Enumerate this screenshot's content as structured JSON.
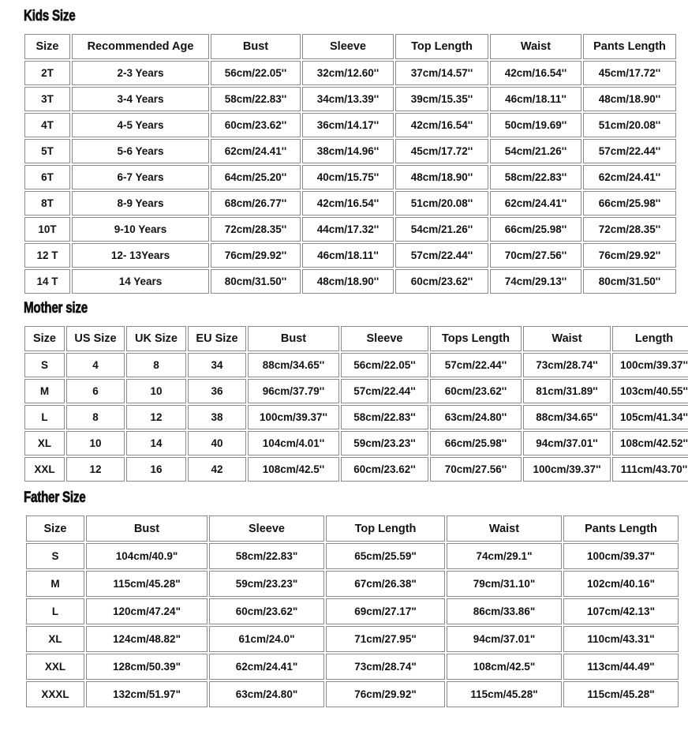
{
  "sections": [
    {
      "title": "Kids Size",
      "headers": [
        "Size",
        "Recommended Age",
        "Bust",
        "Sleeve",
        "Top Length",
        "Waist",
        "Pants Length"
      ],
      "rows": [
        [
          "2T",
          "2-3 Years",
          "56cm/22.05''",
          "32cm/12.60''",
          "37cm/14.57''",
          "42cm/16.54''",
          "45cm/17.72''"
        ],
        [
          "3T",
          "3-4 Years",
          "58cm/22.83''",
          "34cm/13.39''",
          "39cm/15.35''",
          "46cm/18.11''",
          "48cm/18.90''"
        ],
        [
          "4T",
          "4-5 Years",
          "60cm/23.62''",
          "36cm/14.17''",
          "42cm/16.54''",
          "50cm/19.69''",
          "51cm/20.08''"
        ],
        [
          "5T",
          "5-6 Years",
          "62cm/24.41''",
          "38cm/14.96''",
          "45cm/17.72''",
          "54cm/21.26''",
          "57cm/22.44''"
        ],
        [
          "6T",
          "6-7 Years",
          "64cm/25.20''",
          "40cm/15.75''",
          "48cm/18.90''",
          "58cm/22.83''",
          "62cm/24.41''"
        ],
        [
          "8T",
          "8-9 Years",
          "68cm/26.77''",
          "42cm/16.54''",
          "51cm/20.08''",
          "62cm/24.41''",
          "66cm/25.98''"
        ],
        [
          "10T",
          "9-10 Years",
          "72cm/28.35''",
          "44cm/17.32''",
          "54cm/21.26''",
          "66cm/25.98''",
          "72cm/28.35''"
        ],
        [
          "12 T",
          "12- 13Years",
          "76cm/29.92''",
          "46cm/18.11''",
          "57cm/22.44''",
          "70cm/27.56''",
          "76cm/29.92''"
        ],
        [
          "14 T",
          "14  Years",
          "80cm/31.50''",
          "48cm/18.90''",
          "60cm/23.62''",
          "74cm/29.13''",
          "80cm/31.50''"
        ]
      ]
    },
    {
      "title": "Mother size",
      "headers": [
        "Size",
        "US Size",
        "UK Size",
        "EU Size",
        "Bust",
        "Sleeve",
        "Tops Length",
        "Waist",
        "Length"
      ],
      "rows": [
        [
          "S",
          "4",
          "8",
          "34",
          "88cm/34.65''",
          "56cm/22.05''",
          "57cm/22.44''",
          "73cm/28.74''",
          "100cm/39.37''"
        ],
        [
          "M",
          "6",
          "10",
          "36",
          "96cm/37.79''",
          "57cm/22.44''",
          "60cm/23.62''",
          "81cm/31.89''",
          "103cm/40.55''"
        ],
        [
          "L",
          "8",
          "12",
          "38",
          "100cm/39.37''",
          "58cm/22.83''",
          "63cm/24.80''",
          "88cm/34.65''",
          "105cm/41.34''"
        ],
        [
          "XL",
          "10",
          "14",
          "40",
          "104cm/4.01''",
          "59cm/23.23''",
          "66cm/25.98''",
          "94cm/37.01''",
          "108cm/42.52''"
        ],
        [
          "XXL",
          "12",
          "16",
          "42",
          "108cm/42.5''",
          "60cm/23.62''",
          "70cm/27.56''",
          "100cm/39.37''",
          "111cm/43.70''"
        ]
      ]
    },
    {
      "title": "Father Size",
      "headers": [
        "Size",
        "Bust",
        "Sleeve",
        "Top Length",
        "Waist",
        "Pants Length"
      ],
      "rows": [
        [
          "S",
          "104cm/40.9\"",
          "58cm/22.83\"",
          "65cm/25.59\"",
          "74cm/29.1\"",
          "100cm/39.37\""
        ],
        [
          "M",
          "115cm/45.28\"",
          "59cm/23.23\"",
          "67cm/26.38\"",
          "79cm/31.10\"",
          "102cm/40.16\""
        ],
        [
          "L",
          "120cm/47.24\"",
          "60cm/23.62\"",
          "69cm/27.17\"",
          "86cm/33.86\"",
          "107cm/42.13\""
        ],
        [
          "XL",
          "124cm/48.82\"",
          "61cm/24.0\"",
          "71cm/27.95\"",
          "94cm/37.01\"",
          "110cm/43.31\""
        ],
        [
          "XXL",
          "128cm/50.39\"",
          "62cm/24.41\"",
          "73cm/28.74\"",
          "108cm/42.5\"",
          "113cm/44.49\""
        ],
        [
          "XXXL",
          "132cm/51.97\"",
          "63cm/24.80\"",
          "76cm/29.92\"",
          "115cm/45.28\"",
          "115cm/45.28\""
        ]
      ]
    }
  ],
  "watermark": "",
  "colors": {
    "background": "#ffffff",
    "text": "#121212",
    "border": "#8a8a8a"
  }
}
